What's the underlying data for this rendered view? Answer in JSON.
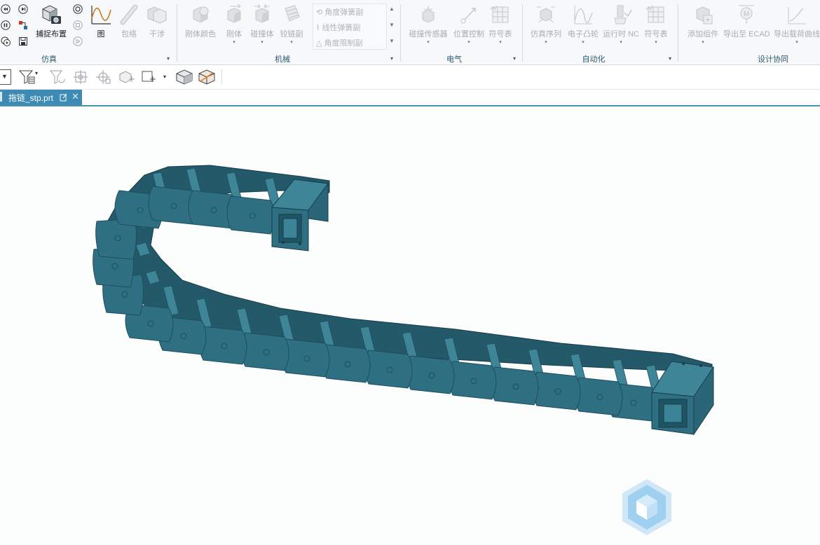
{
  "ribbon": {
    "groups": [
      {
        "id": "sim",
        "title": "仿真"
      },
      {
        "id": "mech",
        "title": "机械"
      },
      {
        "id": "elec",
        "title": "电气"
      },
      {
        "id": "auto",
        "title": "自动化"
      },
      {
        "id": "design",
        "title": "设计协同"
      }
    ],
    "sim": {
      "capture_layout": "捕捉布置",
      "graph": "图",
      "envelope": "包络",
      "interference": "干涉"
    },
    "mech": {
      "rigid_color": "刚体颜色",
      "rigid_body": "刚体",
      "collision_body": "碰撞体",
      "hinge_pair": "铰链副",
      "angle_spring": "角度弹簧副",
      "linear_spring": "线性弹簧副",
      "angle_limit": "角度限制副"
    },
    "elec": {
      "collision_sensor": "碰撞传感器",
      "position_control": "位置控制",
      "symbol_table": "符号表"
    },
    "auto": {
      "sim_sequence": "仿真序列",
      "electronic_cam": "电子凸轮",
      "runtime_nc": "运行时 NC",
      "symbol_table": "符号表"
    },
    "design": {
      "add_component": "添加组件",
      "export_ecad": "导出至 ECAD",
      "export_load_curve": "导出载荷曲线"
    }
  },
  "document": {
    "tab_label": "拖链_stp.prt"
  },
  "colors": {
    "chain_face": "#2f6f82",
    "chain_dark": "#1d4e5e",
    "chain_light": "#3d8597",
    "tab_active": "#3d8ab5",
    "group_title": "#2c5a72"
  },
  "icons": [
    "rewind-icon",
    "step-forward-icon",
    "pause-icon",
    "play-icon",
    "record-icon",
    "stop-icon",
    "capture-layout-icon",
    "graph-icon",
    "envelope-icon",
    "interference-icon",
    "rigid-color-icon",
    "rigid-body-icon",
    "collision-body-icon",
    "hinge-icon",
    "spring-icon",
    "limit-icon",
    "sensor-icon",
    "position-control-icon",
    "symbol-table-icon",
    "sequence-icon",
    "cam-icon",
    "nc-icon",
    "add-component-icon",
    "export-ecad-icon",
    "export-curve-icon",
    "filter-icon",
    "watermark-logo-icon"
  ]
}
